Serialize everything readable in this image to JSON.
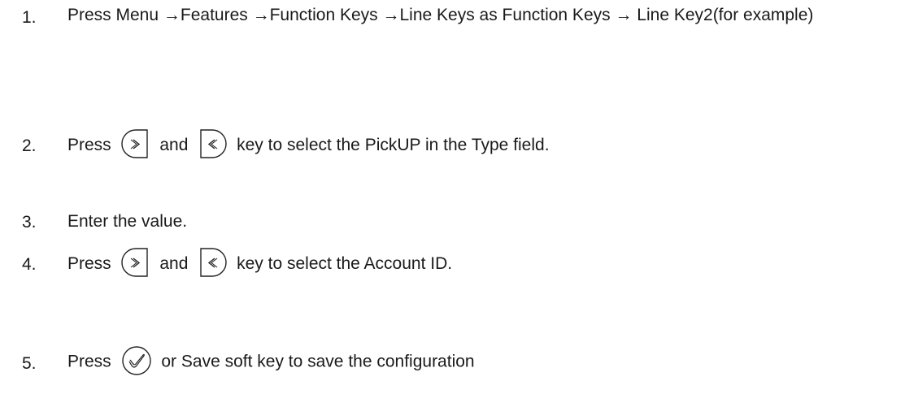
{
  "steps": [
    {
      "number": "1.",
      "text": "Press Menu →Features →Function Keys →Line Keys as Function Keys → Line Key2(for example)"
    },
    {
      "number": "2.",
      "before": "Press",
      "middle": "and",
      "after": "key to select the PickUP in the Type field.",
      "keys": [
        "right-arrow-key",
        "left-arrow-key"
      ]
    },
    {
      "number": "3.",
      "text": "Enter the value."
    },
    {
      "number": "4.",
      "before": "Press",
      "middle": "and",
      "after": "key to select the Account ID.",
      "keys": [
        "right-arrow-key",
        "left-arrow-key"
      ]
    },
    {
      "number": "5.",
      "before": "Press",
      "after": "or Save soft key to save the configuration",
      "keys": [
        "ok-key"
      ]
    }
  ]
}
